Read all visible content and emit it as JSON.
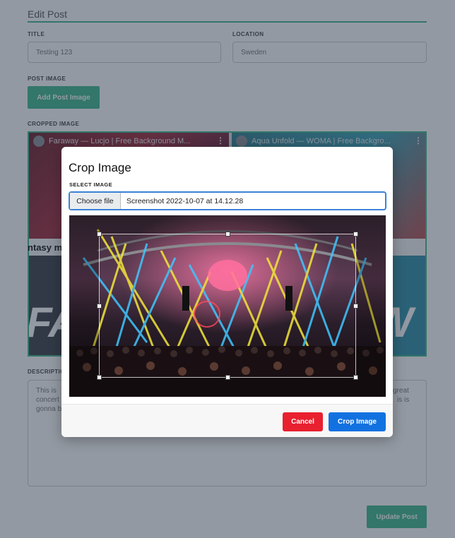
{
  "page": {
    "title": "Edit Post",
    "title_label": "TITLE",
    "title_value": "Testing 123",
    "location_label": "LOCATION",
    "location_value": "Sweden",
    "post_image_label": "POST IMAGE",
    "add_image_button": "Add Post Image",
    "cropped_image_label": "CROPPED IMAGE",
    "video_tiles": [
      {
        "title": "Faraway — Lucjo | Free Background M..."
      },
      {
        "title": "Aqua Unfold — WOMA | Free Backgro..."
      }
    ],
    "fantasy_caption": "ntasy m",
    "description_label": "DESCRIPTION",
    "description_line1": "This is",
    "description_line2": "concert",
    "description_line3": "gonna b",
    "description_right1": "great",
    "description_right2": "is is",
    "update_button": "Update Post"
  },
  "modal": {
    "title": "Crop Image",
    "select_label": "SELECT IMAGE",
    "file_button": "Choose file",
    "file_name": "Screenshot 2022-10-07 at 14.12.28",
    "cancel_button": "Cancel",
    "crop_button": "Crop Image"
  },
  "colors": {
    "accent_green": "#3fb98f",
    "primary_blue": "#1271e0",
    "danger_red": "#e8202f"
  }
}
